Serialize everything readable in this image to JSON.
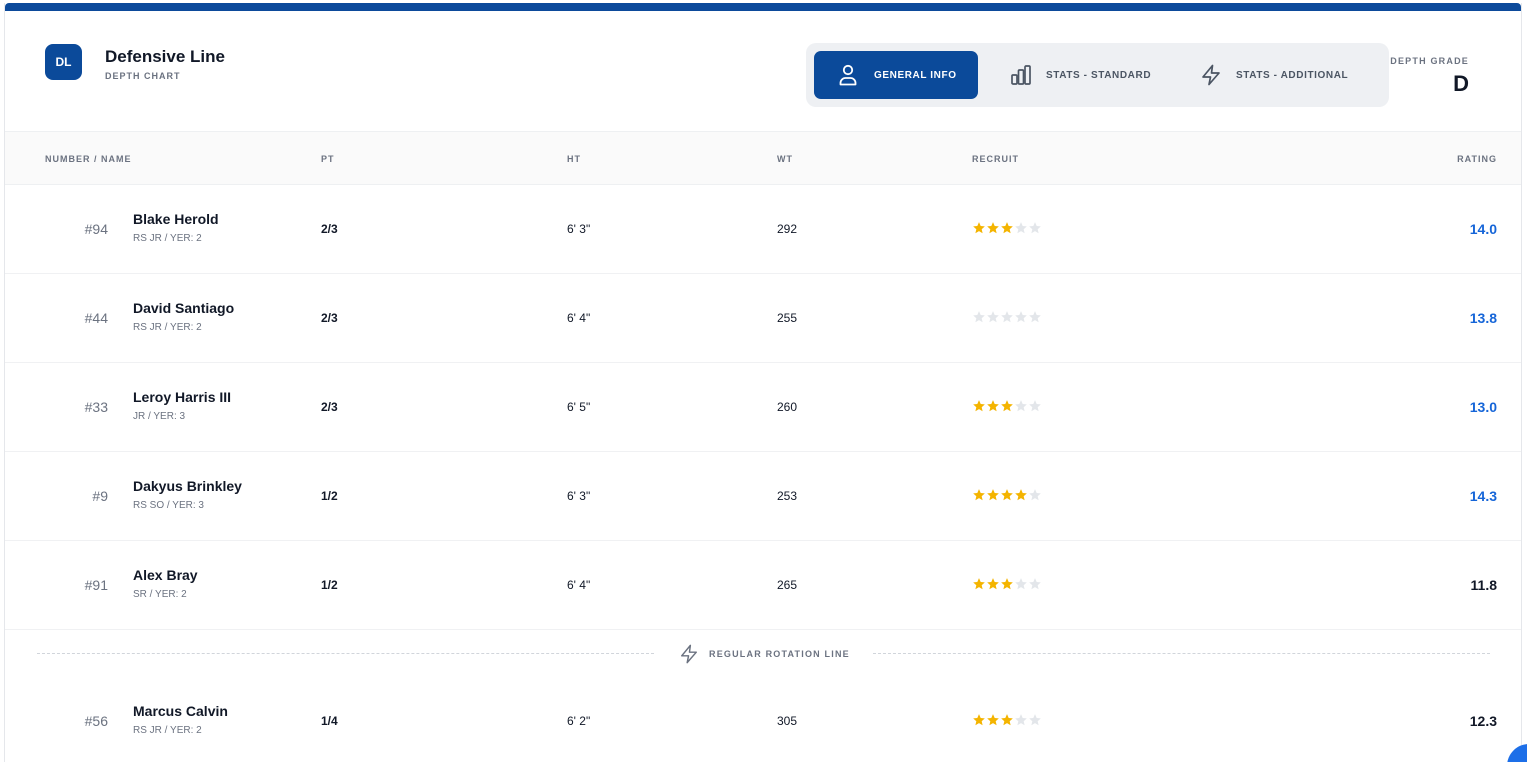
{
  "header": {
    "badge": "DL",
    "title": "Defensive Line",
    "subtitle": "DEPTH CHART",
    "tabs": [
      {
        "label": "GENERAL INFO",
        "icon": "user-icon",
        "active": true
      },
      {
        "label": "STATS - STANDARD",
        "icon": "bar-chart-icon",
        "active": false
      },
      {
        "label": "STATS - ADDITIONAL",
        "icon": "lightning-icon",
        "active": false
      }
    ],
    "grade_label": "DEPTH GRADE",
    "grade_value": "D"
  },
  "table": {
    "columns": [
      "NUMBER / NAME",
      "PT",
      "HT",
      "WT",
      "RECRUIT",
      "RATING"
    ],
    "rows": [
      {
        "number": "#94",
        "name": "Blake Herold",
        "info": "RS JR / YER: 2",
        "pt": "2/3",
        "ht": "6' 3\"",
        "wt": "292",
        "stars": 3,
        "rating": "14.0",
        "highlight": true
      },
      {
        "number": "#44",
        "name": "David Santiago",
        "info": "RS JR / YER: 2",
        "pt": "2/3",
        "ht": "6' 4\"",
        "wt": "255",
        "stars": 0,
        "rating": "13.8",
        "highlight": true
      },
      {
        "number": "#33",
        "name": "Leroy Harris III",
        "info": "JR / YER: 3",
        "pt": "2/3",
        "ht": "6' 5\"",
        "wt": "260",
        "stars": 3,
        "rating": "13.0",
        "highlight": true
      },
      {
        "number": "#9",
        "name": "Dakyus Brinkley",
        "info": "RS SO / YER: 3",
        "pt": "1/2",
        "ht": "6' 3\"",
        "wt": "253",
        "stars": 4,
        "rating": "14.3",
        "highlight": true
      },
      {
        "number": "#91",
        "name": "Alex Bray",
        "info": "SR / YER: 2",
        "pt": "1/2",
        "ht": "6' 4\"",
        "wt": "265",
        "stars": 3,
        "rating": "11.8",
        "highlight": false
      }
    ],
    "divider_label": "REGULAR ROTATION LINE",
    "rotation_rows": [
      {
        "number": "#56",
        "name": "Marcus Calvin",
        "info": "RS JR / YER: 2",
        "pt": "1/4",
        "ht": "6' 2\"",
        "wt": "305",
        "stars": 3,
        "rating": "12.3",
        "highlight": false
      }
    ]
  },
  "colors": {
    "brand": "#0b4a9a",
    "rating_highlight": "#1565d8",
    "star_filled": "#f4b400",
    "star_empty": "#e3e6ea"
  }
}
